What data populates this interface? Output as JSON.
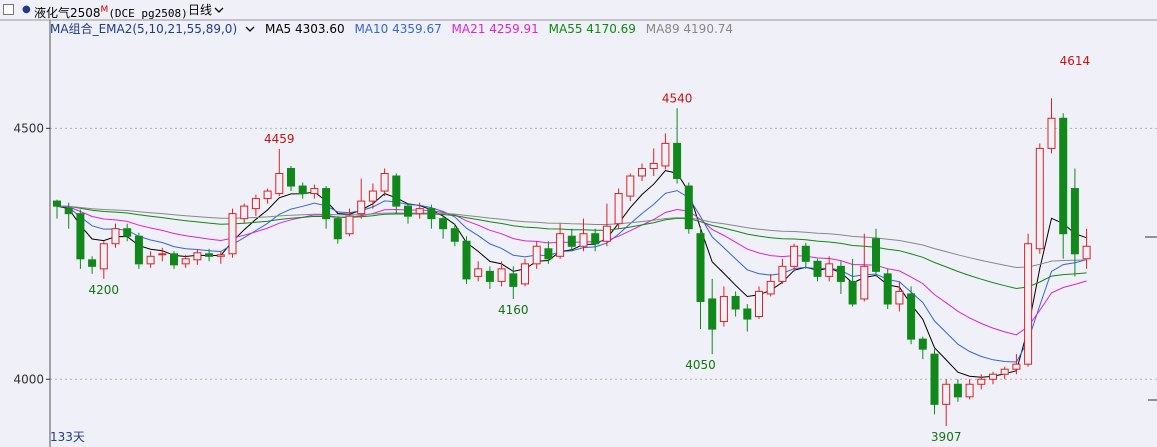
{
  "header": {
    "instrument_name": "液化气2508",
    "instrument_flag": "M",
    "instrument_code": "(DCE pg2508)",
    "period": "日线",
    "period_icon": "chevron-down-icon"
  },
  "legend": {
    "group_label": "MA组合_EMA2(5,10,21,55,89,0)",
    "items": [
      {
        "text": "MA5 4303.60",
        "color": "#000000"
      },
      {
        "text": "MA10 4359.67",
        "color": "#3366dd"
      },
      {
        "text": "MA21 4259.91",
        "color": "#dd22dd"
      },
      {
        "text": "MA55 4170.69",
        "color": "#118811"
      },
      {
        "text": "MA89 4190.74",
        "color": "#888888"
      }
    ]
  },
  "footer": {
    "day_count": "133天"
  },
  "colors": {
    "up": "#dd2222",
    "down": "#11881a",
    "background": "#f0f0f8"
  },
  "chart_data": {
    "type": "candlestick",
    "y_ticks": [
      4000,
      4500
    ],
    "ylim": [
      3865,
      4680
    ],
    "grid": "dotted horizontal",
    "annotations": [
      {
        "index": 4,
        "value": 4200,
        "label": "4200",
        "kind": "low"
      },
      {
        "index": 19,
        "value": 4459,
        "label": "4459",
        "kind": "high"
      },
      {
        "index": 39,
        "value": 4160,
        "label": "4160",
        "kind": "low"
      },
      {
        "index": 53,
        "value": 4540,
        "label": "4540",
        "kind": "high"
      },
      {
        "index": 55,
        "value": 4050,
        "label": "4050",
        "kind": "low"
      },
      {
        "index": 76,
        "value": 3907,
        "label": "3907",
        "kind": "low"
      },
      {
        "index": 87,
        "value": 4614,
        "label": "4614",
        "kind": "high"
      }
    ],
    "candles": [
      [
        4355,
        4345,
        4358,
        4320
      ],
      [
        4340,
        4330,
        4352,
        4300
      ],
      [
        4330,
        4240,
        4338,
        4220
      ],
      [
        4238,
        4225,
        4245,
        4210
      ],
      [
        4220,
        4270,
        4275,
        4200
      ],
      [
        4270,
        4300,
        4310,
        4262
      ],
      [
        4300,
        4285,
        4310,
        4275
      ],
      [
        4285,
        4230,
        4292,
        4220
      ],
      [
        4230,
        4245,
        4255,
        4222
      ],
      [
        4248,
        4250,
        4262,
        4235
      ],
      [
        4250,
        4228,
        4255,
        4220
      ],
      [
        4230,
        4240,
        4248,
        4222
      ],
      [
        4238,
        4252,
        4258,
        4228
      ],
      [
        4250,
        4245,
        4260,
        4235
      ],
      [
        4245,
        4248,
        4255,
        4230
      ],
      [
        4250,
        4330,
        4340,
        4242
      ],
      [
        4320,
        4345,
        4350,
        4310
      ],
      [
        4340,
        4360,
        4368,
        4325
      ],
      [
        4360,
        4375,
        4380,
        4350
      ],
      [
        4370,
        4410,
        4459,
        4365
      ],
      [
        4420,
        4385,
        4425,
        4375
      ],
      [
        4385,
        4370,
        4392,
        4360
      ],
      [
        4370,
        4380,
        4388,
        4360
      ],
      [
        4380,
        4320,
        4385,
        4300
      ],
      [
        4320,
        4280,
        4325,
        4270
      ],
      [
        4290,
        4325,
        4340,
        4285
      ],
      [
        4330,
        4355,
        4400,
        4320
      ],
      [
        4355,
        4375,
        4390,
        4340
      ],
      [
        4375,
        4410,
        4420,
        4365
      ],
      [
        4405,
        4345,
        4410,
        4330
      ],
      [
        4345,
        4325,
        4350,
        4310
      ],
      [
        4330,
        4340,
        4352,
        4320
      ],
      [
        4340,
        4320,
        4348,
        4300
      ],
      [
        4320,
        4300,
        4325,
        4280
      ],
      [
        4300,
        4275,
        4310,
        4265
      ],
      [
        4275,
        4200,
        4285,
        4190
      ],
      [
        4205,
        4220,
        4235,
        4195
      ],
      [
        4215,
        4195,
        4225,
        4180
      ],
      [
        4195,
        4220,
        4235,
        4185
      ],
      [
        4210,
        4185,
        4225,
        4160
      ],
      [
        4190,
        4230,
        4240,
        4185
      ],
      [
        4230,
        4265,
        4275,
        4220
      ],
      [
        4260,
        4240,
        4275,
        4230
      ],
      [
        4245,
        4290,
        4310,
        4240
      ],
      [
        4285,
        4265,
        4300,
        4255
      ],
      [
        4265,
        4290,
        4320,
        4255
      ],
      [
        4290,
        4270,
        4300,
        4255
      ],
      [
        4275,
        4305,
        4350,
        4265
      ],
      [
        4310,
        4370,
        4380,
        4300
      ],
      [
        4365,
        4405,
        4410,
        4355
      ],
      [
        4405,
        4420,
        4430,
        4395
      ],
      [
        4420,
        4430,
        4460,
        4405
      ],
      [
        4425,
        4470,
        4490,
        4418
      ],
      [
        4470,
        4400,
        4540,
        4390
      ],
      [
        4385,
        4300,
        4392,
        4290
      ],
      [
        4290,
        4155,
        4305,
        4100
      ],
      [
        4160,
        4100,
        4200,
        4050
      ],
      [
        4115,
        4165,
        4185,
        4105
      ],
      [
        4165,
        4140,
        4175,
        4125
      ],
      [
        4140,
        4120,
        4150,
        4095
      ],
      [
        4125,
        4175,
        4185,
        4120
      ],
      [
        4170,
        4195,
        4210,
        4165
      ],
      [
        4195,
        4225,
        4240,
        4190
      ],
      [
        4225,
        4265,
        4270,
        4215
      ],
      [
        4265,
        4235,
        4272,
        4220
      ],
      [
        4235,
        4205,
        4240,
        4195
      ],
      [
        4205,
        4230,
        4245,
        4195
      ],
      [
        4225,
        4195,
        4235,
        4170
      ],
      [
        4195,
        4150,
        4240,
        4145
      ],
      [
        4160,
        4225,
        4290,
        4155
      ],
      [
        4280,
        4215,
        4300,
        4205
      ],
      [
        4210,
        4150,
        4220,
        4140
      ],
      [
        4150,
        4175,
        4195,
        4135
      ],
      [
        4170,
        4080,
        4185,
        4070
      ],
      [
        4080,
        4060,
        4085,
        4040
      ],
      [
        4050,
        3950,
        4060,
        3930
      ],
      [
        3950,
        3990,
        4000,
        3907
      ],
      [
        3990,
        3965,
        4000,
        3955
      ],
      [
        3965,
        3990,
        4000,
        3960
      ],
      [
        3990,
        4000,
        4010,
        3980
      ],
      [
        4000,
        4010,
        4015,
        3990
      ],
      [
        4010,
        4020,
        4025,
        4000
      ],
      [
        4020,
        4030,
        4050,
        4010
      ],
      [
        4030,
        4270,
        4290,
        4025
      ],
      [
        4260,
        4460,
        4470,
        4250
      ],
      [
        4460,
        4520,
        4560,
        4450
      ],
      [
        4520,
        4290,
        4530,
        4240
      ],
      [
        4380,
        4250,
        4420,
        4205
      ],
      [
        4240,
        4265,
        4300,
        4220
      ]
    ]
  }
}
